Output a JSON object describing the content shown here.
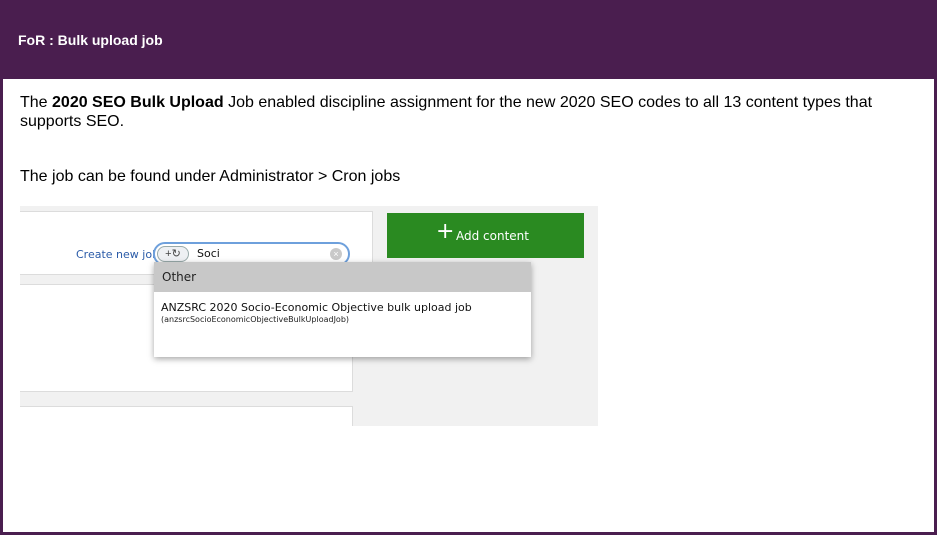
{
  "panel": {
    "title": "FoR : Bulk upload job"
  },
  "body": {
    "intro_prefix": "The ",
    "intro_bold": "2020 SEO Bulk Upload",
    "intro_suffix": " Job enabled discipline assignment for the new 2020 SEO codes to all 13 content types that supports SEO.",
    "location": "The job can be found under Administrator > Cron jobs"
  },
  "screenshot": {
    "create_link": "Create new job",
    "search_value": "Soci",
    "search_button_glyph": "+↻",
    "clear_glyph": "×",
    "dropdown_header": "Other",
    "result_title": "ANZSRC 2020 Socio-Economic Objective bulk upload job",
    "result_subtitle": "(anzsrcSocioEconomicObjectiveBulkUploadJob)",
    "add_button_plus": "+",
    "add_button_label": "Add content"
  },
  "colors": {
    "header_bg": "#4a1e4f",
    "add_button": "#2a8a21",
    "link": "#2a5ba8"
  }
}
